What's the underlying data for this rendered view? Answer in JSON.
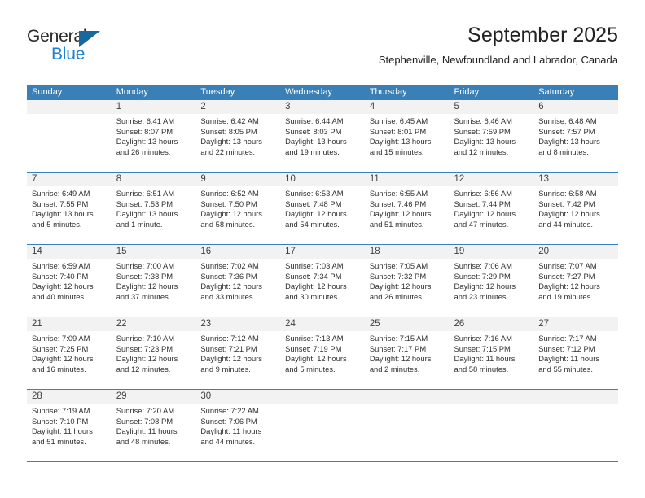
{
  "brand": {
    "name_top": "General",
    "name_bottom": "Blue",
    "triangle_color": "#17689e",
    "blue_color": "#1b81d4"
  },
  "header": {
    "title": "September 2025",
    "subtitle": "Stephenville, Newfoundland and Labrador, Canada"
  },
  "theme": {
    "header_blue": "#3a7fb5",
    "day_band_grey": "#f2f2f2",
    "separator_blue": "#3a7fb5",
    "text": "#2f2f2f"
  },
  "calendar": {
    "weekday_headers": [
      "Sunday",
      "Monday",
      "Tuesday",
      "Wednesday",
      "Thursday",
      "Friday",
      "Saturday"
    ],
    "weeks": [
      {
        "days": [
          {
            "num": "",
            "sunrise": "",
            "sunset": "",
            "daylight1": "",
            "daylight2": ""
          },
          {
            "num": "1",
            "sunrise": "Sunrise: 6:41 AM",
            "sunset": "Sunset: 8:07 PM",
            "daylight1": "Daylight: 13 hours",
            "daylight2": "and 26 minutes."
          },
          {
            "num": "2",
            "sunrise": "Sunrise: 6:42 AM",
            "sunset": "Sunset: 8:05 PM",
            "daylight1": "Daylight: 13 hours",
            "daylight2": "and 22 minutes."
          },
          {
            "num": "3",
            "sunrise": "Sunrise: 6:44 AM",
            "sunset": "Sunset: 8:03 PM",
            "daylight1": "Daylight: 13 hours",
            "daylight2": "and 19 minutes."
          },
          {
            "num": "4",
            "sunrise": "Sunrise: 6:45 AM",
            "sunset": "Sunset: 8:01 PM",
            "daylight1": "Daylight: 13 hours",
            "daylight2": "and 15 minutes."
          },
          {
            "num": "5",
            "sunrise": "Sunrise: 6:46 AM",
            "sunset": "Sunset: 7:59 PM",
            "daylight1": "Daylight: 13 hours",
            "daylight2": "and 12 minutes."
          },
          {
            "num": "6",
            "sunrise": "Sunrise: 6:48 AM",
            "sunset": "Sunset: 7:57 PM",
            "daylight1": "Daylight: 13 hours",
            "daylight2": "and 8 minutes."
          }
        ]
      },
      {
        "days": [
          {
            "num": "7",
            "sunrise": "Sunrise: 6:49 AM",
            "sunset": "Sunset: 7:55 PM",
            "daylight1": "Daylight: 13 hours",
            "daylight2": "and 5 minutes."
          },
          {
            "num": "8",
            "sunrise": "Sunrise: 6:51 AM",
            "sunset": "Sunset: 7:53 PM",
            "daylight1": "Daylight: 13 hours",
            "daylight2": "and 1 minute."
          },
          {
            "num": "9",
            "sunrise": "Sunrise: 6:52 AM",
            "sunset": "Sunset: 7:50 PM",
            "daylight1": "Daylight: 12 hours",
            "daylight2": "and 58 minutes."
          },
          {
            "num": "10",
            "sunrise": "Sunrise: 6:53 AM",
            "sunset": "Sunset: 7:48 PM",
            "daylight1": "Daylight: 12 hours",
            "daylight2": "and 54 minutes."
          },
          {
            "num": "11",
            "sunrise": "Sunrise: 6:55 AM",
            "sunset": "Sunset: 7:46 PM",
            "daylight1": "Daylight: 12 hours",
            "daylight2": "and 51 minutes."
          },
          {
            "num": "12",
            "sunrise": "Sunrise: 6:56 AM",
            "sunset": "Sunset: 7:44 PM",
            "daylight1": "Daylight: 12 hours",
            "daylight2": "and 47 minutes."
          },
          {
            "num": "13",
            "sunrise": "Sunrise: 6:58 AM",
            "sunset": "Sunset: 7:42 PM",
            "daylight1": "Daylight: 12 hours",
            "daylight2": "and 44 minutes."
          }
        ]
      },
      {
        "days": [
          {
            "num": "14",
            "sunrise": "Sunrise: 6:59 AM",
            "sunset": "Sunset: 7:40 PM",
            "daylight1": "Daylight: 12 hours",
            "daylight2": "and 40 minutes."
          },
          {
            "num": "15",
            "sunrise": "Sunrise: 7:00 AM",
            "sunset": "Sunset: 7:38 PM",
            "daylight1": "Daylight: 12 hours",
            "daylight2": "and 37 minutes."
          },
          {
            "num": "16",
            "sunrise": "Sunrise: 7:02 AM",
            "sunset": "Sunset: 7:36 PM",
            "daylight1": "Daylight: 12 hours",
            "daylight2": "and 33 minutes."
          },
          {
            "num": "17",
            "sunrise": "Sunrise: 7:03 AM",
            "sunset": "Sunset: 7:34 PM",
            "daylight1": "Daylight: 12 hours",
            "daylight2": "and 30 minutes."
          },
          {
            "num": "18",
            "sunrise": "Sunrise: 7:05 AM",
            "sunset": "Sunset: 7:32 PM",
            "daylight1": "Daylight: 12 hours",
            "daylight2": "and 26 minutes."
          },
          {
            "num": "19",
            "sunrise": "Sunrise: 7:06 AM",
            "sunset": "Sunset: 7:29 PM",
            "daylight1": "Daylight: 12 hours",
            "daylight2": "and 23 minutes."
          },
          {
            "num": "20",
            "sunrise": "Sunrise: 7:07 AM",
            "sunset": "Sunset: 7:27 PM",
            "daylight1": "Daylight: 12 hours",
            "daylight2": "and 19 minutes."
          }
        ]
      },
      {
        "days": [
          {
            "num": "21",
            "sunrise": "Sunrise: 7:09 AM",
            "sunset": "Sunset: 7:25 PM",
            "daylight1": "Daylight: 12 hours",
            "daylight2": "and 16 minutes."
          },
          {
            "num": "22",
            "sunrise": "Sunrise: 7:10 AM",
            "sunset": "Sunset: 7:23 PM",
            "daylight1": "Daylight: 12 hours",
            "daylight2": "and 12 minutes."
          },
          {
            "num": "23",
            "sunrise": "Sunrise: 7:12 AM",
            "sunset": "Sunset: 7:21 PM",
            "daylight1": "Daylight: 12 hours",
            "daylight2": "and 9 minutes."
          },
          {
            "num": "24",
            "sunrise": "Sunrise: 7:13 AM",
            "sunset": "Sunset: 7:19 PM",
            "daylight1": "Daylight: 12 hours",
            "daylight2": "and 5 minutes."
          },
          {
            "num": "25",
            "sunrise": "Sunrise: 7:15 AM",
            "sunset": "Sunset: 7:17 PM",
            "daylight1": "Daylight: 12 hours",
            "daylight2": "and 2 minutes."
          },
          {
            "num": "26",
            "sunrise": "Sunrise: 7:16 AM",
            "sunset": "Sunset: 7:15 PM",
            "daylight1": "Daylight: 11 hours",
            "daylight2": "and 58 minutes."
          },
          {
            "num": "27",
            "sunrise": "Sunrise: 7:17 AM",
            "sunset": "Sunset: 7:12 PM",
            "daylight1": "Daylight: 11 hours",
            "daylight2": "and 55 minutes."
          }
        ]
      },
      {
        "days": [
          {
            "num": "28",
            "sunrise": "Sunrise: 7:19 AM",
            "sunset": "Sunset: 7:10 PM",
            "daylight1": "Daylight: 11 hours",
            "daylight2": "and 51 minutes."
          },
          {
            "num": "29",
            "sunrise": "Sunrise: 7:20 AM",
            "sunset": "Sunset: 7:08 PM",
            "daylight1": "Daylight: 11 hours",
            "daylight2": "and 48 minutes."
          },
          {
            "num": "30",
            "sunrise": "Sunrise: 7:22 AM",
            "sunset": "Sunset: 7:06 PM",
            "daylight1": "Daylight: 11 hours",
            "daylight2": "and 44 minutes."
          },
          {
            "num": "",
            "sunrise": "",
            "sunset": "",
            "daylight1": "",
            "daylight2": ""
          },
          {
            "num": "",
            "sunrise": "",
            "sunset": "",
            "daylight1": "",
            "daylight2": ""
          },
          {
            "num": "",
            "sunrise": "",
            "sunset": "",
            "daylight1": "",
            "daylight2": ""
          },
          {
            "num": "",
            "sunrise": "",
            "sunset": "",
            "daylight1": "",
            "daylight2": ""
          }
        ]
      }
    ]
  }
}
